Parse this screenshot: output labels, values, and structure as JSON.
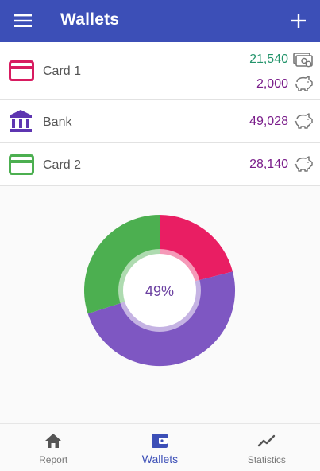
{
  "appbar": {
    "title": "Wallets",
    "menu_icon": "hamburger-menu-icon",
    "add_icon": "plus-icon"
  },
  "wallets": [
    {
      "name": "Card 1",
      "icon": "credit-card-icon",
      "color": "#d81b60",
      "balances": [
        {
          "value": "21,540",
          "color": "#23946b",
          "icon": "cash-icon"
        },
        {
          "value": "2,000",
          "color": "#7a1d8a",
          "icon": "piggy-bank-icon"
        }
      ]
    },
    {
      "name": "Bank",
      "icon": "bank-icon",
      "color": "#5e35b1",
      "balances": [
        {
          "value": "49,028",
          "color": "#7a1d8a",
          "icon": "piggy-bank-icon"
        }
      ]
    },
    {
      "name": "Card 2",
      "icon": "credit-card-icon",
      "color": "#4caf50",
      "balances": [
        {
          "value": "28,140",
          "color": "#7a1d8a",
          "icon": "piggy-bank-icon"
        }
      ]
    }
  ],
  "chart_data": {
    "type": "pie",
    "center_label": "49%",
    "slices": [
      {
        "value": 21,
        "color": "#e91e63"
      },
      {
        "value": 49,
        "color": "#7e57c2"
      },
      {
        "value": 30,
        "color": "#4caf50"
      }
    ]
  },
  "bottom_nav": [
    {
      "label": "Report",
      "icon": "home-icon",
      "active": false
    },
    {
      "label": "Wallets",
      "icon": "wallet-icon",
      "active": true
    },
    {
      "label": "Statistics",
      "icon": "trend-line-icon",
      "active": false
    }
  ],
  "colors": {
    "primary": "#3c4fb7"
  }
}
